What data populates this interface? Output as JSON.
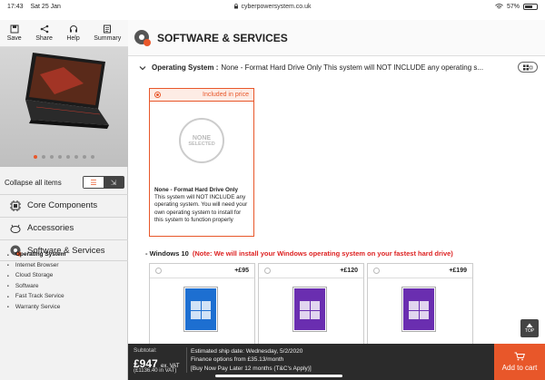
{
  "statusbar": {
    "time": "17:43",
    "date": "Sat 25 Jan",
    "url": "cyberpowersystem.co.uk",
    "battery": "57%"
  },
  "toolbar": {
    "save": "Save",
    "share": "Share",
    "help": "Help",
    "summary": "Summary"
  },
  "carousel": {
    "slides": 8,
    "active_index": 0
  },
  "collapse": {
    "label": "Collapse all items"
  },
  "nav": {
    "core": "Core Components",
    "accessories": "Accessories",
    "software": "Software & Services"
  },
  "sub_items": [
    "Operating System",
    "Internet Browser",
    "Cloud Storage",
    "Software",
    "Fast Track Service",
    "Warranty Service"
  ],
  "main": {
    "title": "SOFTWARE & SERVICES",
    "section_label": "Operating System :",
    "section_value": "None - Format Hard Drive Only This system will NOT INCLUDE any operating s..."
  },
  "os_card": {
    "badge": "Included in price",
    "circle_top": "NONE",
    "circle_bottom": "SELECTED",
    "name": "None - Format Hard Drive Only",
    "description": "This system will NOT INCLUDE any operating system. You will need your own operating system to install for this system to function properly"
  },
  "windows": {
    "label": "- Windows 10",
    "note": "(Note: We will install your Windows operating system on your fastest hard drive)",
    "options": [
      {
        "price": "+£95",
        "color": "#1d6fd1"
      },
      {
        "price": "+£120",
        "color": "#6a2eb0"
      },
      {
        "price": "+£199",
        "color": "#6a2eb0"
      }
    ]
  },
  "top_button": "TOP",
  "footer": {
    "subtotal_label": "Subtotal:",
    "price": "£947",
    "ex_vat": "ex. VAT",
    "inc_vat": "(£1136.40 in VAT)",
    "ship": "Estimated ship date: Wednesday, 5/2/2020",
    "finance": "Finance options from £35.13/month",
    "buy_now": "[Buy Now Pay Later 12 months (T&C's Apply)]",
    "cart": "Add to cart"
  },
  "colors": {
    "accent": "#e8572a",
    "footer": "#2b2b2b",
    "warning": "#dd2222"
  }
}
